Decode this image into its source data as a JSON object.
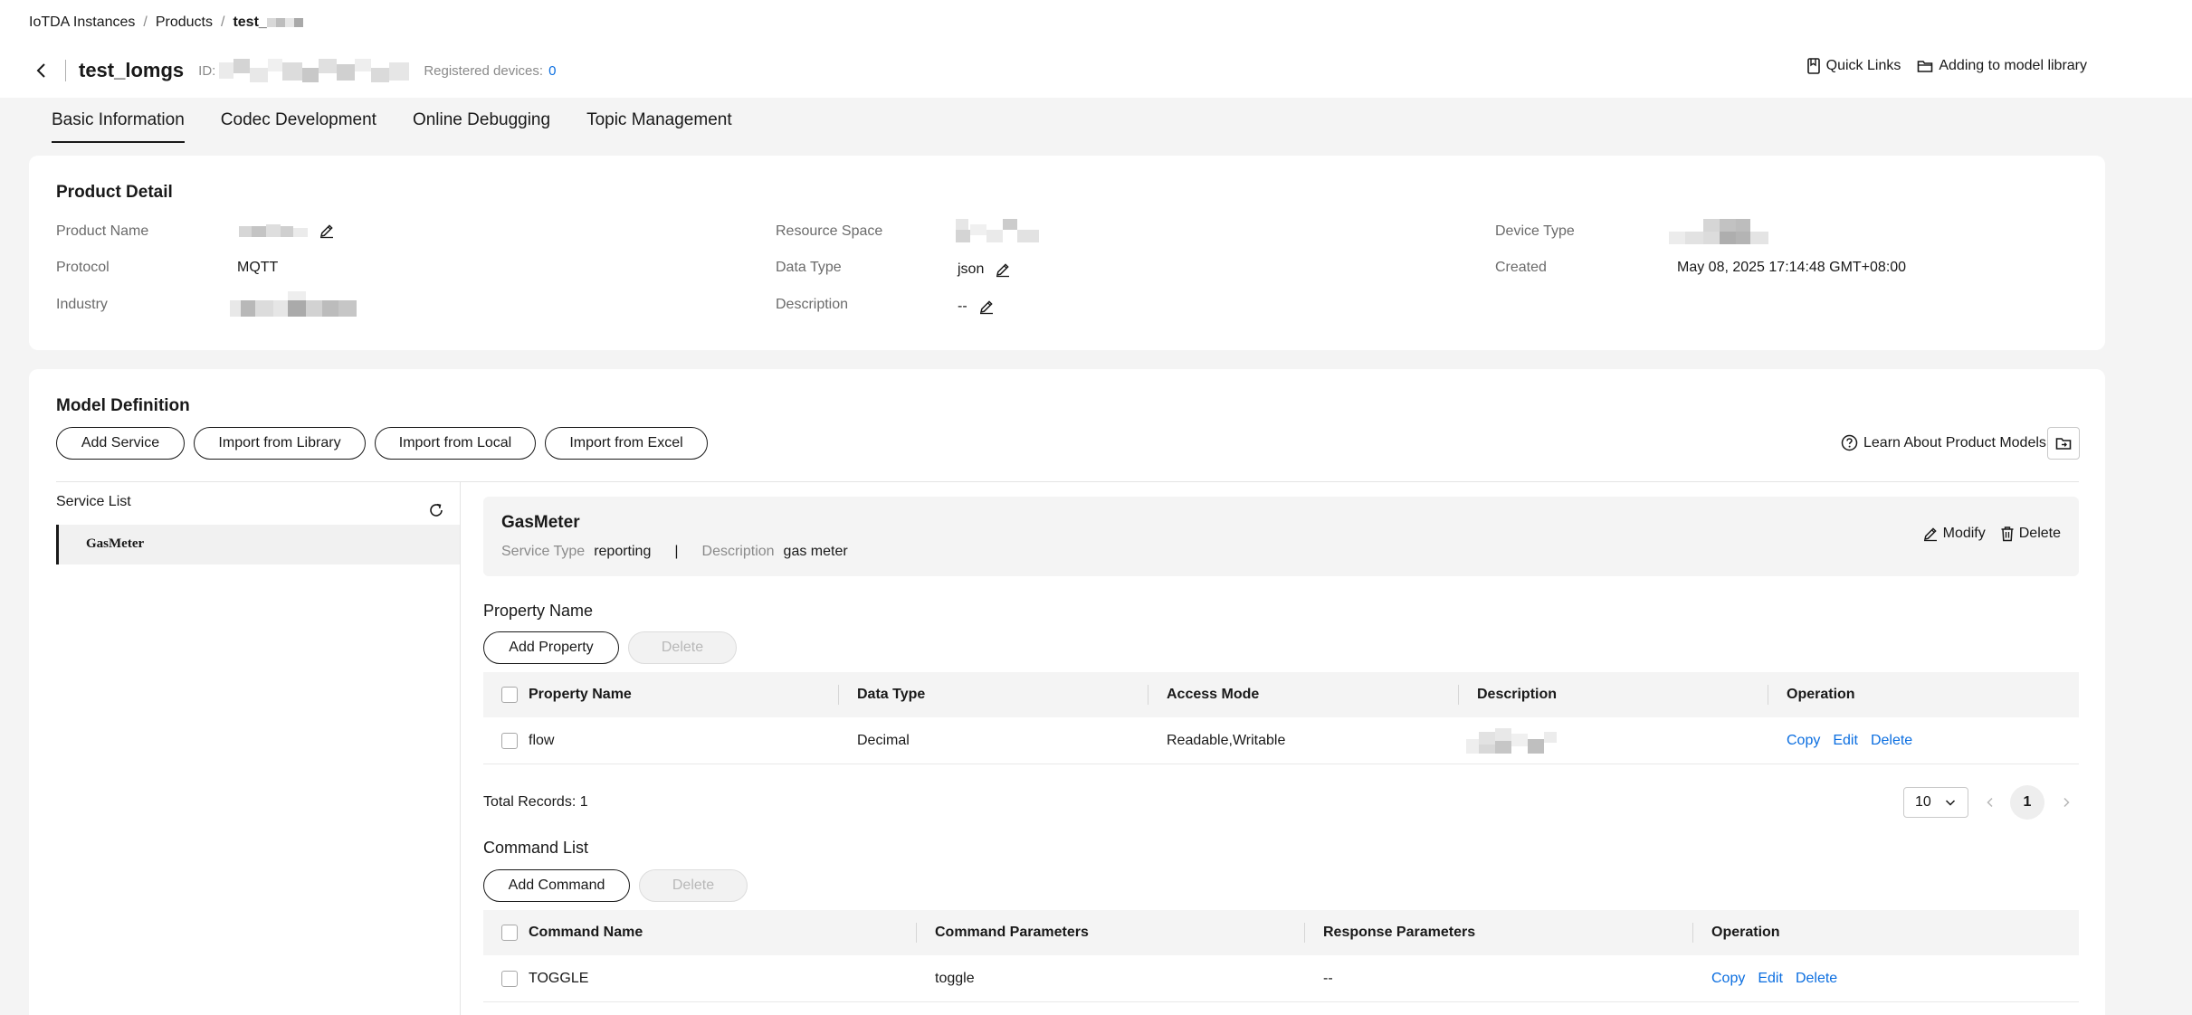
{
  "breadcrumb": {
    "items": [
      "IoTDA Instances",
      "Products"
    ],
    "current": "test_"
  },
  "header": {
    "title": "test_lomgs",
    "id_label": "ID:",
    "registered_label": "Registered devices:",
    "registered_count": "0",
    "quick_links": "Quick Links",
    "add_to_library": "Adding to model library"
  },
  "tabs": [
    {
      "label": "Basic Information",
      "active": true
    },
    {
      "label": "Codec Development"
    },
    {
      "label": "Online Debugging"
    },
    {
      "label": "Topic Management"
    }
  ],
  "product_detail": {
    "title": "Product Detail",
    "product_name_label": "Product Name",
    "protocol_label": "Protocol",
    "protocol_value": "MQTT",
    "industry_label": "Industry",
    "resource_space_label": "Resource Space",
    "data_type_label": "Data Type",
    "data_type_value": "json",
    "description_label": "Description",
    "description_value": "--",
    "device_type_label": "Device Type",
    "created_label": "Created",
    "created_value": "May 08, 2025 17:14:48 GMT+08:00"
  },
  "model_definition": {
    "title": "Model Definition",
    "buttons": {
      "add_service": "Add Service",
      "import_library": "Import from Library",
      "import_local": "Import from Local",
      "import_excel": "Import from Excel"
    },
    "learn_link": "Learn About Product Models",
    "service_list_label": "Service List",
    "services": [
      "GasMeter"
    ]
  },
  "service": {
    "name": "GasMeter",
    "type_label": "Service Type",
    "type_value": "reporting",
    "separator": "|",
    "desc_label": "Description",
    "desc_value": "gas meter",
    "modify": "Modify",
    "delete": "Delete"
  },
  "properties": {
    "title": "Property Name",
    "add_button": "Add Property",
    "delete_button": "Delete",
    "columns": [
      "Property Name",
      "Data Type",
      "Access Mode",
      "Description",
      "Operation"
    ],
    "rows": [
      {
        "name": "flow",
        "data_type": "Decimal",
        "access_mode": "Readable,Writable"
      }
    ],
    "ops": [
      "Copy",
      "Edit",
      "Delete"
    ],
    "total": "Total Records: 1",
    "page_size": "10",
    "page": "1"
  },
  "commands": {
    "title": "Command List",
    "add_button": "Add Command",
    "delete_button": "Delete",
    "columns": [
      "Command Name",
      "Command Parameters",
      "Response Parameters",
      "Operation"
    ],
    "rows": [
      {
        "name": "TOGGLE",
        "params": "toggle",
        "response": "--"
      }
    ],
    "ops": [
      "Copy",
      "Edit",
      "Delete"
    ]
  },
  "colors": {
    "link": "#0b6ee0",
    "page_bg": "#f4f4f4",
    "card_bg": "#ffffff",
    "text": "#191919"
  },
  "icons": [
    "chevron-left-icon",
    "edit-icon",
    "bookmark-icon",
    "folder-icon",
    "refresh-icon",
    "help-circle-icon",
    "trash-icon",
    "chevron-down-icon",
    "chevron-right-icon"
  ]
}
